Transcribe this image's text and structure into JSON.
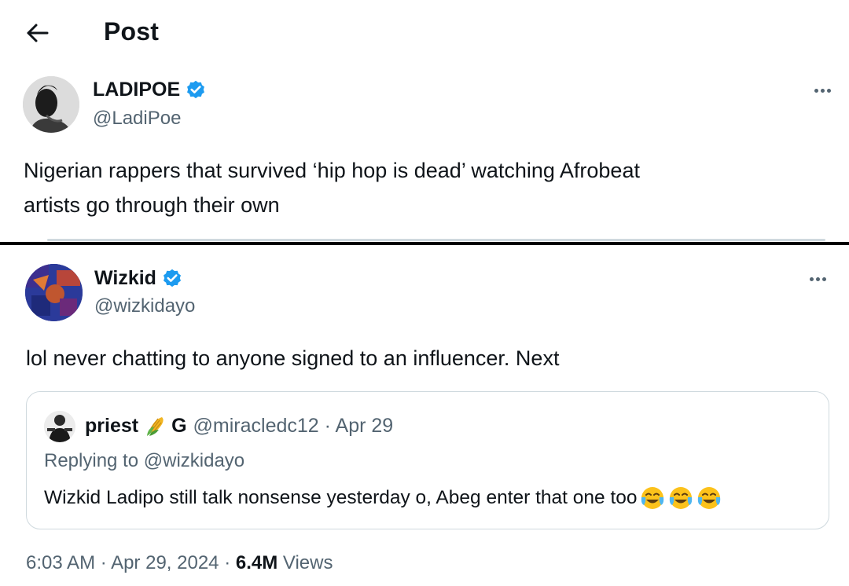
{
  "header": {
    "title": "Post",
    "back_icon": "back-arrow-icon"
  },
  "original_post": {
    "display_name": "LADIPOE",
    "handle": "@LadiPoe",
    "verified": true,
    "text_line1": "Nigerian rappers that survived ‘hip hop is dead’ watching Afrobeat",
    "text_line2": "artists go through their own"
  },
  "reply_post": {
    "display_name": "Wizkid",
    "handle": "@wizkidayo",
    "verified": true,
    "text": "lol never chatting to anyone signed to an influencer. Next",
    "timestamp_time": "6:03 AM",
    "timestamp_date": "Apr 29, 2024",
    "views_count": "6.4M",
    "views_label": "Views",
    "separator": "·"
  },
  "quoted_post": {
    "display_name": "priest",
    "name_suffix": "G",
    "handle_meta": "@miracledc12 · Apr 29",
    "replying_prefix": "Replying to",
    "replying_handle": "@wizkidayo",
    "text": "Wizkid Ladipo still talk nonsense yesterday o, Abeg enter that one too"
  },
  "colors": {
    "verified_blue": "#1d9bf0",
    "secondary_text": "#536471",
    "primary_text": "#0f1419",
    "border": "#cfd9de"
  }
}
